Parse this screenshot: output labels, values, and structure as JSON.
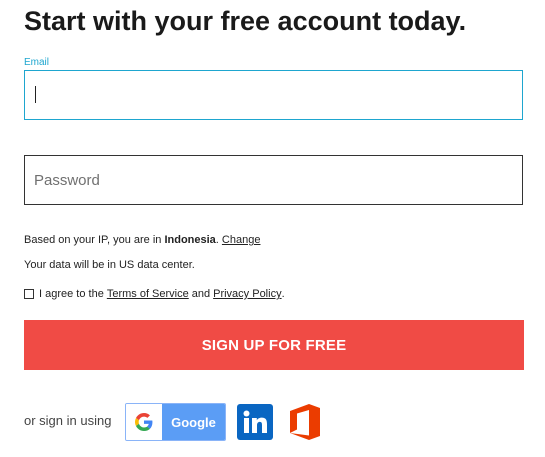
{
  "heading": "Start with your free account today.",
  "email": {
    "label": "Email",
    "value": "",
    "placeholder": ""
  },
  "password": {
    "value": "",
    "placeholder": "Password"
  },
  "location": {
    "prefix": "Based on your IP, you are in",
    "country": "Indonesia",
    "suffix": ".",
    "change_link": "Change"
  },
  "data_center": "Your data will be in US data center.",
  "agree": {
    "prefix": "I agree to the",
    "terms_link": "Terms of Service",
    "and": "and",
    "privacy_link": "Privacy Policy",
    "suffix": "."
  },
  "signup_button": "SIGN UP FOR FREE",
  "social": {
    "label": "or sign in using",
    "google_label": "Google",
    "icons": [
      "google-icon",
      "linkedin-icon",
      "office-icon"
    ]
  },
  "colors": {
    "accent": "#1ea6cf",
    "signup_bg": "#f04b45",
    "google_blue": "#5b9df5",
    "linkedin_blue": "#0a66c2",
    "office_orange": "#eb3c00"
  }
}
